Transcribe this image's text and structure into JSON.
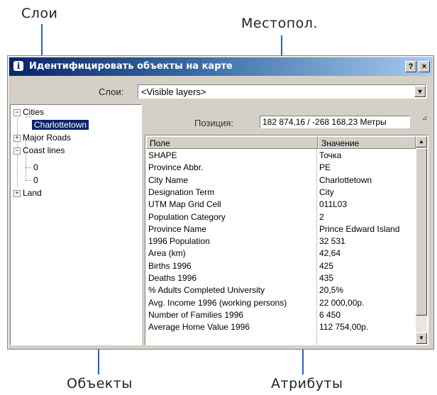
{
  "callouts": {
    "layers": "Слои",
    "position": "Местопол.",
    "objects": "Объекты",
    "attributes": "Атрибуты"
  },
  "window": {
    "title": "Идентифицировать объекты на карте",
    "help_label": "?",
    "close_label": "×",
    "info_label": "i"
  },
  "layers_select": {
    "label": "Слои:",
    "value": "<Visible layers>"
  },
  "tree": {
    "cities": "Cities",
    "charlottetown": "Charlottetown",
    "major_roads": "Major Roads",
    "coast_lines": "Coast lines",
    "coast_child_1": "0",
    "coast_child_2": "0",
    "land": "Land"
  },
  "position": {
    "label": "Позиция:",
    "value": "182 874,16 / -268 168,23 Метры"
  },
  "table": {
    "headers": {
      "field": "Поле",
      "value": "Значение"
    },
    "rows": [
      {
        "field": "SHAPE",
        "value": "Точка"
      },
      {
        "field": "Province Abbr.",
        "value": "PE"
      },
      {
        "field": "City Name",
        "value": "Charlottetown"
      },
      {
        "field": "Designation Term",
        "value": "City"
      },
      {
        "field": "UTM Map Grid Cell",
        "value": "011L03"
      },
      {
        "field": "Population Category",
        "value": "2"
      },
      {
        "field": "Province Name",
        "value": "Prince Edward Island"
      },
      {
        "field": "1996 Population",
        "value": "32 531"
      },
      {
        "field": "Area (km)",
        "value": "42,64"
      },
      {
        "field": "Births 1996",
        "value": "425"
      },
      {
        "field": "Deaths 1996",
        "value": "435"
      },
      {
        "field": "% Adults Completed University",
        "value": "20,5%"
      },
      {
        "field": "Avg. Income 1996 (working persons)",
        "value": "22 000,00p."
      },
      {
        "field": "Number of Families 1996",
        "value": "6 450"
      },
      {
        "field": "Average Home Value 1996",
        "value": "112 754,00p."
      }
    ]
  }
}
